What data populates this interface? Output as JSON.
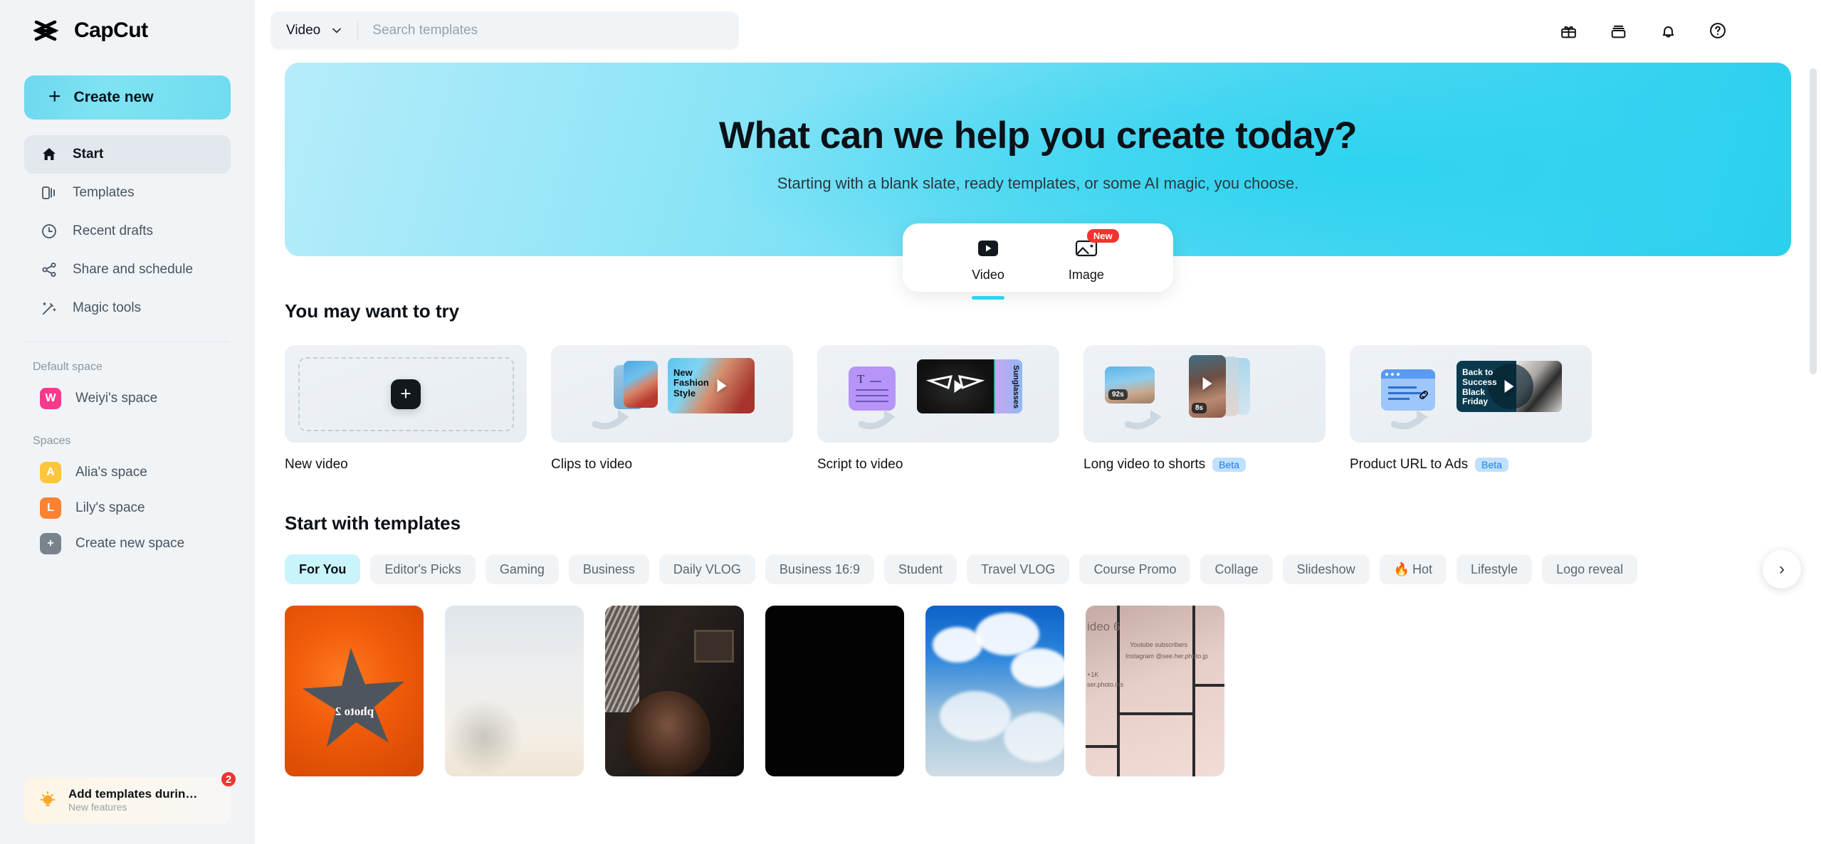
{
  "brand": {
    "name": "CapCut",
    "logo_icon": "capcut-logo-icon"
  },
  "sidebar": {
    "create_new_label": "Create new",
    "nav_items": [
      {
        "label": "Start",
        "icon": "home-icon",
        "active": true
      },
      {
        "label": "Templates",
        "icon": "templates-icon",
        "active": false
      },
      {
        "label": "Recent drafts",
        "icon": "clock-icon",
        "active": false
      },
      {
        "label": "Share and schedule",
        "icon": "share-icon",
        "active": false
      },
      {
        "label": "Magic tools",
        "icon": "magic-wand-icon",
        "active": false
      }
    ],
    "default_space_label": "Default space",
    "default_space": {
      "label": "Weiyi's space",
      "initial": "W",
      "color": "#f5398d"
    },
    "spaces_label": "Spaces",
    "spaces": [
      {
        "label": "Alia's space",
        "initial": "A",
        "color": "#ffc53d"
      },
      {
        "label": "Lily's space",
        "initial": "L",
        "color": "#fa8231"
      },
      {
        "label": "Create new space",
        "initial": "+",
        "color": "#78838d"
      }
    ],
    "promo": {
      "title": "Add templates durin…",
      "subtitle": "New features",
      "badge_count": "2",
      "icon": "lightbulb-icon"
    }
  },
  "topbar": {
    "search_type": "Video",
    "search_placeholder": "Search templates",
    "search_value": "",
    "icons": [
      "gift-icon",
      "inbox-icon",
      "bell-icon",
      "help-circle-icon"
    ],
    "avatar": "user-avatar"
  },
  "hero": {
    "title": "What can we help you create today?",
    "subtitle": "Starting with a blank slate, ready templates, or some AI magic, you choose.",
    "gradient_from": "#b6ecfa",
    "gradient_to": "#29cfee",
    "mode_tabs": [
      {
        "label": "Video",
        "icon": "video-play-icon",
        "active": true,
        "badge": ""
      },
      {
        "label": "Image",
        "icon": "image-icon",
        "active": false,
        "badge": "New"
      }
    ],
    "accent_color": "#2ed3ef"
  },
  "try_section": {
    "title": "You may want to try",
    "cards": [
      {
        "label": "New video",
        "badge": "",
        "thumb": "new-video-thumb"
      },
      {
        "label": "Clips to video",
        "badge": "",
        "thumb": "clips-to-video-thumb",
        "overlay_text": "New Fashion Style"
      },
      {
        "label": "Script to video",
        "badge": "",
        "thumb": "script-to-video-thumb",
        "overlay_text": "Sunglasses"
      },
      {
        "label": "Long video to shorts",
        "badge": "Beta",
        "thumb": "long-video-to-shorts-thumb",
        "duration_long": "92s",
        "duration_short": "8s"
      },
      {
        "label": "Product URL to Ads",
        "badge": "Beta",
        "thumb": "product-url-to-ads-thumb",
        "overlay_text": "Back to Success Black Friday"
      }
    ]
  },
  "templates_section": {
    "title": "Start with templates",
    "chips": [
      {
        "label": "For You",
        "active": true,
        "emoji": ""
      },
      {
        "label": "Editor's Picks",
        "active": false,
        "emoji": ""
      },
      {
        "label": "Gaming",
        "active": false,
        "emoji": ""
      },
      {
        "label": "Business",
        "active": false,
        "emoji": ""
      },
      {
        "label": "Daily VLOG",
        "active": false,
        "emoji": ""
      },
      {
        "label": "Business 16:9",
        "active": false,
        "emoji": ""
      },
      {
        "label": "Student",
        "active": false,
        "emoji": ""
      },
      {
        "label": "Travel VLOG",
        "active": false,
        "emoji": ""
      },
      {
        "label": "Course Promo",
        "active": false,
        "emoji": ""
      },
      {
        "label": "Collage",
        "active": false,
        "emoji": ""
      },
      {
        "label": "Slideshow",
        "active": false,
        "emoji": ""
      },
      {
        "label": "Hot",
        "active": false,
        "emoji": "🔥"
      },
      {
        "label": "Lifestyle",
        "active": false,
        "emoji": ""
      },
      {
        "label": "Logo reveal",
        "active": false,
        "emoji": ""
      }
    ],
    "next_arrow": "›",
    "thumbnails": [
      {
        "name": "orange-star-template",
        "caption_text": "photo 2"
      },
      {
        "name": "bright-sky-template",
        "caption_text": ""
      },
      {
        "name": "portrait-dark-template",
        "caption_text": ""
      },
      {
        "name": "black-template",
        "caption_text": ""
      },
      {
        "name": "clouds-mountain-template",
        "caption_text": ""
      },
      {
        "name": "collage-pink-template",
        "caption_text": "ideo 6"
      }
    ]
  }
}
